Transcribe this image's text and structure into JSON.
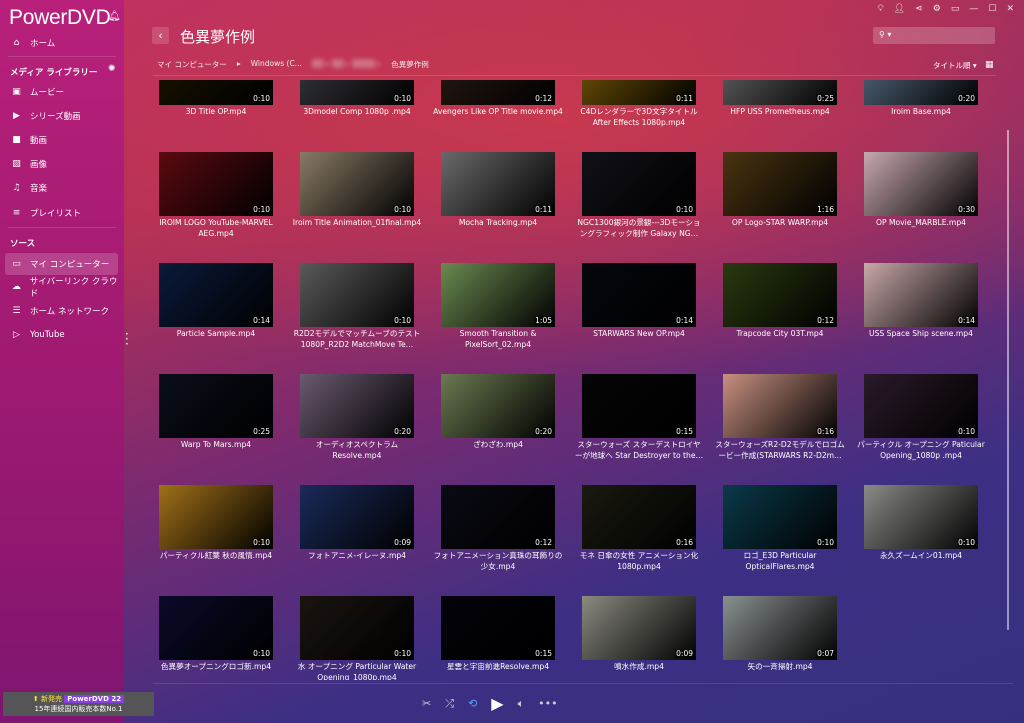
{
  "app": {
    "name": "PowerDVD",
    "notify_icon": "bell-icon"
  },
  "sidebar": {
    "home": {
      "label": "ホーム",
      "icon": "home-icon"
    },
    "media_library_title": "メディア ライブラリー",
    "media_items": [
      {
        "label": "ムービー",
        "icon": "movie-icon"
      },
      {
        "label": "シリーズ動画",
        "icon": "tv-series-icon"
      },
      {
        "label": "動画",
        "icon": "video-camera-icon"
      },
      {
        "label": "画像",
        "icon": "image-icon"
      },
      {
        "label": "音楽",
        "icon": "music-icon"
      },
      {
        "label": "プレイリスト",
        "icon": "playlist-icon"
      }
    ],
    "sources_title": "ソース",
    "source_items": [
      {
        "label": "マイ コンピューター",
        "icon": "laptop-icon",
        "selected": true
      },
      {
        "label": "サイバーリンク クラウド",
        "icon": "cloud-icon"
      },
      {
        "label": "ホーム ネットワーク",
        "icon": "network-icon"
      },
      {
        "label": "YouTube",
        "icon": "youtube-icon"
      }
    ],
    "promo": {
      "badge": "新発売",
      "product": "PowerDVD 22",
      "tagline": "15年連続国内販売本数No.1"
    }
  },
  "header": {
    "title": "色異夢作例",
    "search_placeholder": "",
    "breadcrumb": [
      "マイ コンピューター",
      "Windows (C...",
      "色異夢作例"
    ],
    "sort_label": "タイトル順 ▾"
  },
  "colors": {
    "accent": "#5aa0ff",
    "sidebar": "#a01a72",
    "promo_badge": "#8a3fe0"
  },
  "items": [
    {
      "name": "3D Title OP.mp4",
      "duration": "0:10",
      "color": "#1a1400"
    },
    {
      "name": "3Dmodel Comp 1080p .mp4",
      "duration": "0:10",
      "color": "#3a3a44"
    },
    {
      "name": "Avengers Like OP Title movie.mp4",
      "duration": "0:12",
      "color": "#2a1a14"
    },
    {
      "name": "C4Dレンダラーで3D文字タイトル After Effects 1080p.mp4",
      "duration": "0:11",
      "color": "#7a5a08"
    },
    {
      "name": "HFP USS Prometheus.mp4",
      "duration": "0:25",
      "color": "#6a6a6a"
    },
    {
      "name": "Iroim Base.mp4",
      "duration": "0:20",
      "color": "#5a7088"
    },
    {
      "name": "IROIM LOGO YouTube-MARVEL AEG.mp4",
      "duration": "0:10",
      "color": "#5a0a10"
    },
    {
      "name": "Iroim Title Animation_01final.mp4",
      "duration": "0:10",
      "color": "#8a7a66"
    },
    {
      "name": "Mocha Tracking.mp4",
      "duration": "0:11",
      "color": "#6a6a6a"
    },
    {
      "name": "NGC1300銀河の景観---3Dモーショングラフィック制作 Galaxy NG…",
      "duration": "0:10",
      "color": "#101018"
    },
    {
      "name": "OP Logo-STAR WARP.mp4",
      "duration": "1:16",
      "color": "#4a3412"
    },
    {
      "name": "OP Movie_MARBLE.mp4",
      "duration": "0:30",
      "color": "#c8a8b0"
    },
    {
      "name": "Particle Sample.mp4",
      "duration": "0:14",
      "color": "#0a1a3a"
    },
    {
      "name": "R2D2モデルでマッチムーブのテスト 1080P_R2D2  MatchMove Te…",
      "duration": "0:10",
      "color": "#5a5a5a"
    },
    {
      "name": "Smooth Transition & PixelSort_02.mp4",
      "duration": "1:05",
      "color": "#6a8a50"
    },
    {
      "name": "STARWARS New OP.mp4",
      "duration": "0:14",
      "color": "#05070e"
    },
    {
      "name": "Trapcode City 03T.mp4",
      "duration": "0:12",
      "color": "#2a3a10"
    },
    {
      "name": "USS Space Ship scene.mp4",
      "duration": "0:14",
      "color": "#c8a8a8"
    },
    {
      "name": "Warp To Mars.mp4",
      "duration": "0:25",
      "color": "#0a0e1a"
    },
    {
      "name": "オーディオスペクトラム Resolve.mp4",
      "duration": "0:20",
      "color": "#6a5a70"
    },
    {
      "name": "ざわざわ.mp4",
      "duration": "0:20",
      "color": "#6a7a50"
    },
    {
      "name": "スターウォーズ スターデストロイヤーが地球へ Star Destroyer to the…",
      "duration": "0:15",
      "color": "#050505"
    },
    {
      "name": "スターウォーズR2-D2モデルでロゴムービー作成(STARWARS  R2-D2m…",
      "duration": "0:16",
      "color": "#c89080"
    },
    {
      "name": "パーティクル オープニング Paticular Opening_1080p .mp4",
      "duration": "0:10",
      "color": "#2a1a2a"
    },
    {
      "name": "パーティクル紅葉 秋の風情.mp4",
      "duration": "0:10",
      "color": "#a07018"
    },
    {
      "name": "フォトアニメ-イレーヌ.mp4",
      "duration": "0:09",
      "color": "#1a2a5a"
    },
    {
      "name": "フォトアニメーション真珠の耳飾りの少女.mp4",
      "duration": "0:12",
      "color": "#0a0a14"
    },
    {
      "name": "モネ 日傘の女性 アニメーション化 1080p.mp4",
      "duration": "0:16",
      "color": "#1a1a10"
    },
    {
      "name": "ロゴ_E3D  Particular OpticalFlares.mp4",
      "duration": "0:10",
      "color": "#0a3a4a"
    },
    {
      "name": "永久ズームイン01.mp4",
      "duration": "0:10",
      "color": "#8a8a88"
    },
    {
      "name": "色異夢オープニングロゴ新.mp4",
      "duration": "0:10",
      "color": "#0a0a2a"
    },
    {
      "name": "水 オープニング Particular  Water Opening_1080p.mp4",
      "duration": "0:10",
      "color": "#1a1410"
    },
    {
      "name": "星雲と宇宙前進Resolve.mp4",
      "duration": "0:15",
      "color": "#03030a"
    },
    {
      "name": "噴水作成.mp4",
      "duration": "0:09",
      "color": "#8a8a80"
    },
    {
      "name": "矢の一斉掃射.mp4",
      "duration": "0:07",
      "color": "#8a9090"
    }
  ],
  "player": {
    "controls": [
      "scissors-icon",
      "shuffle-icon",
      "repeat-icon",
      "play-icon",
      "volume-icon",
      "more-icon"
    ]
  }
}
